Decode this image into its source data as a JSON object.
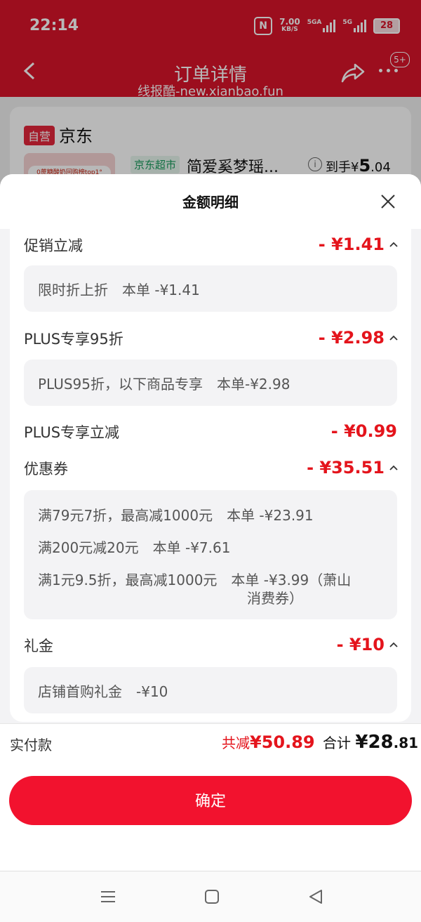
{
  "status": {
    "time": "22:14",
    "speed": "7.00",
    "speed_unit": "KB/S",
    "sig1_label": "5GA",
    "sig2_label": "5G",
    "battery": "28"
  },
  "nav": {
    "title": "订单详情",
    "badge": "5+",
    "watermark": "线报酷-new.xianbao.fun"
  },
  "store": {
    "tag": "自营",
    "name": "京东",
    "product_tag": "京东超市",
    "product_name": "简爱奚梦瑶...",
    "thumb_text": "0蔗糖酸奶回购榜top1°",
    "daoshou_label": "到手",
    "daoshou_currency": "¥",
    "daoshou_price": "5",
    "daoshou_decimal": ".04"
  },
  "sheet": {
    "title": "金额明细",
    "rows": {
      "promo": {
        "label": "促销立减",
        "amount": "- ¥1.41",
        "detail": "限时折上折　本单 -¥1.41"
      },
      "plus95": {
        "label": "PLUS专享95折",
        "amount": "- ¥2.98",
        "detail": "PLUS95折，以下商品专享　本单-¥2.98"
      },
      "pluscut": {
        "label": "PLUS专享立减",
        "amount": "- ¥0.99"
      },
      "coupon": {
        "label": "优惠券",
        "amount": "- ¥35.51",
        "line1": "满79元7折，最高减1000元　本单 -¥23.91",
        "line2": "满200元减20元　本单 -¥7.61",
        "line3a": "满1元9.5折，最高减1000元　本单 -¥3.99（萧山",
        "line3b": "消费券）"
      },
      "gift": {
        "label": "礼金",
        "amount": "- ¥10",
        "detail": "店铺首购礼金　-¥10"
      }
    }
  },
  "summary": {
    "pay_label": "实付款",
    "reduce_label": "共减",
    "reduce_amount": "¥50.89",
    "sum_label": "合计",
    "sum_currency": "¥",
    "sum_int": "28",
    "sum_dec": ".81"
  },
  "actions": {
    "confirm": "确定"
  },
  "colors": {
    "brand_red": "#d8142a",
    "price_red": "#e4141c",
    "button_red": "#f2122e"
  }
}
